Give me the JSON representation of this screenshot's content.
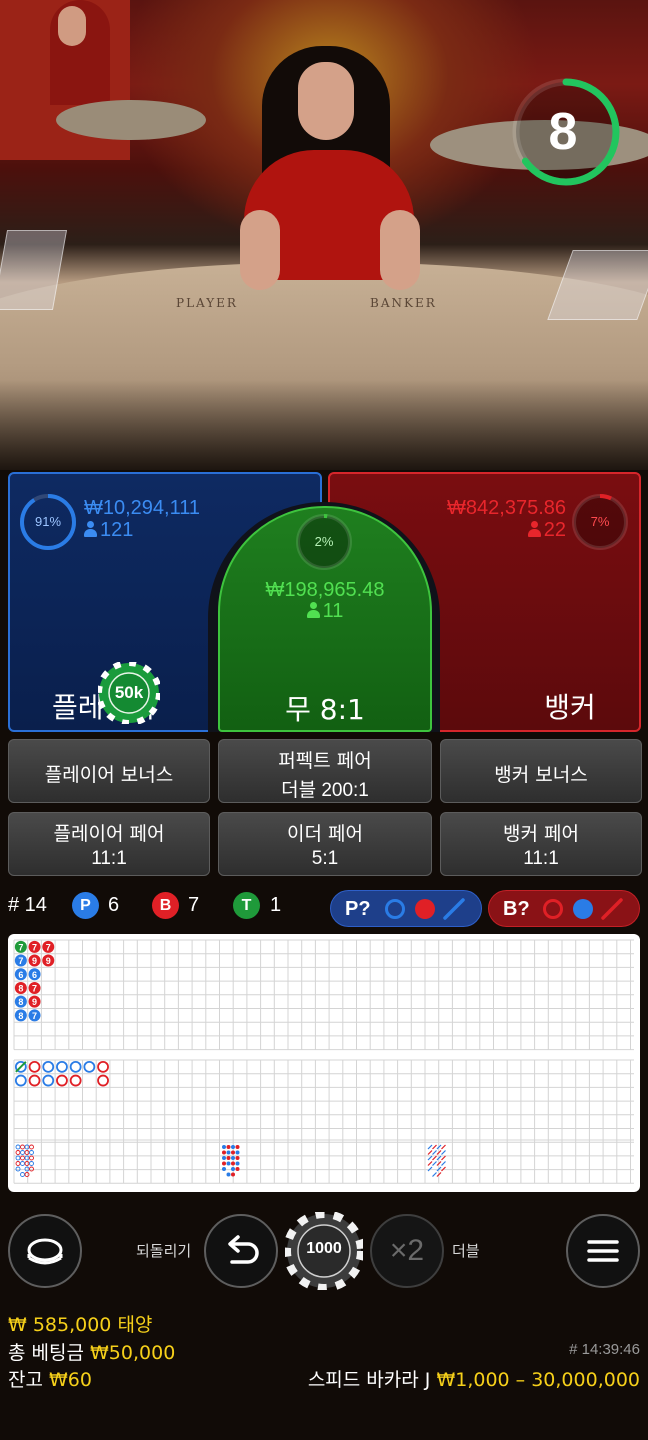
{
  "timer": {
    "seconds": "8",
    "fraction_remaining": 0.65
  },
  "table_felt": {
    "player": "PLAYER",
    "banker": "BANKER"
  },
  "player": {
    "percent": "91%",
    "percent_value": 0.91,
    "amount": "₩10,294,111",
    "players": "121",
    "label": "플레이어",
    "chip": "50k"
  },
  "tie": {
    "percent": "2%",
    "percent_value": 0.02,
    "amount": "₩198,965.48",
    "players": "11",
    "label": "무 8:1"
  },
  "banker": {
    "percent": "7%",
    "percent_value": 0.07,
    "amount": "₩842,375.86",
    "players": "22",
    "label": "뱅커"
  },
  "side_bets": {
    "player_bonus": "플레이어 보너스",
    "perfect_pair": {
      "name": "퍼펙트 페어",
      "payout": "더블 200:1"
    },
    "banker_bonus": "뱅커 보너스",
    "player_pair": {
      "name": "플레이어 페어",
      "payout": "11:1"
    },
    "either_pair": {
      "name": "이더 페어",
      "payout": "5:1"
    },
    "banker_pair": {
      "name": "뱅커 페어",
      "payout": "11:1"
    }
  },
  "stats": {
    "round": "# 14",
    "player_letter": "P",
    "player_count": "6",
    "banker_letter": "B",
    "banker_count": "7",
    "tie_letter": "T",
    "tie_count": "1",
    "player_predict": "P?",
    "banker_predict": "B?"
  },
  "roadmap": {
    "bead_columns": [
      [
        {
          "n": "7",
          "c": "tie"
        },
        {
          "n": "7",
          "c": "player"
        },
        {
          "n": "6",
          "c": "player"
        },
        {
          "n": "8",
          "c": "banker"
        },
        {
          "n": "8",
          "c": "player"
        },
        {
          "n": "8",
          "c": "player"
        }
      ],
      [
        {
          "n": "7",
          "c": "banker"
        },
        {
          "n": "9",
          "c": "banker"
        },
        {
          "n": "6",
          "c": "player"
        },
        {
          "n": "7",
          "c": "banker"
        },
        {
          "n": "9",
          "c": "banker"
        },
        {
          "n": "7",
          "c": "player"
        }
      ],
      [
        {
          "n": "7",
          "c": "banker"
        },
        {
          "n": "9",
          "c": "banker"
        }
      ]
    ],
    "big_road_columns": [
      [
        "player-tie",
        "player"
      ],
      [
        "banker",
        "banker"
      ],
      [
        "player",
        "player"
      ],
      [
        "player",
        "banker"
      ],
      [
        "player",
        "banker"
      ],
      [
        "player"
      ],
      [
        "banker",
        "banker"
      ]
    ]
  },
  "controls": {
    "undo_label": "되돌리기",
    "chip_value": "1000",
    "double_symbol": "×2",
    "double_label": "더블"
  },
  "footer": {
    "win_amount": "₩ 585,000",
    "win_label": "태양",
    "total_bet_label": "총 베팅금",
    "total_bet": "₩50,000",
    "balance_label": "잔고",
    "balance": "₩60",
    "game_id": "# 14:39:46",
    "table_name": "스피드 바카라 J",
    "limits": "₩1,000 – 30,000,000"
  },
  "colors": {
    "player": "#2a7ce6",
    "banker": "#e02026",
    "tie": "#1f9a3a",
    "yellow": "#f6d01a",
    "timer": "#22c55e"
  },
  "icons": [
    "person-icon",
    "undo-icon",
    "menu-icon",
    "table-view-icon"
  ]
}
